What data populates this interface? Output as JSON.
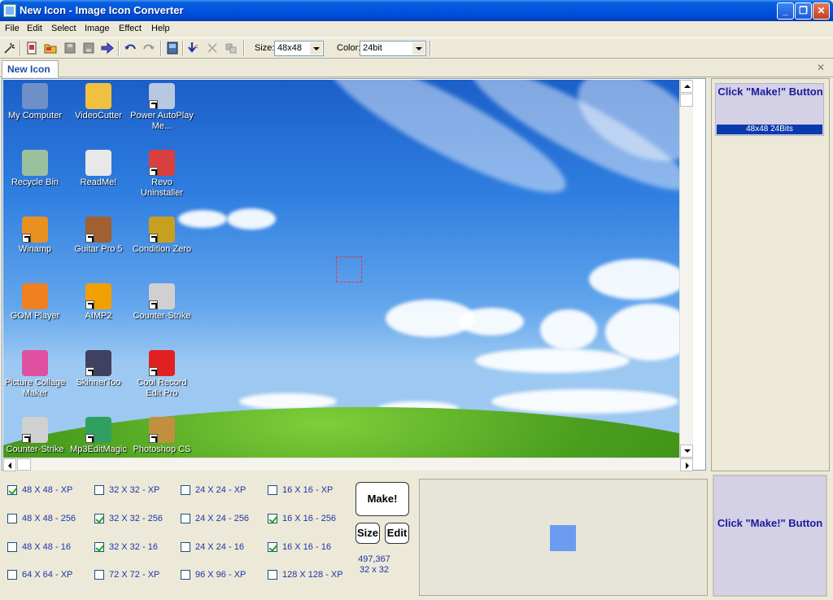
{
  "window": {
    "title": "New Icon - Image Icon Converter",
    "minimize_glyph": "_",
    "maximize_glyph": "❐",
    "close_glyph": "✕"
  },
  "menu": [
    "File",
    "Edit",
    "Select",
    "Image",
    "Effect",
    "Help"
  ],
  "toolbar": {
    "size_label": "Size:",
    "size_value": "48x48",
    "color_label": "Color:",
    "color_value": "24bit"
  },
  "tab": {
    "label": "New Icon",
    "close_glyph": "✕"
  },
  "desktop_icons": [
    {
      "label": "My Computer",
      "color": "#6e8fc8",
      "shortcut": false
    },
    {
      "label": "VideoCutter",
      "color": "#f0c040",
      "shortcut": false
    },
    {
      "label": "Power AutoPlay Me...",
      "color": "#b8c8e0",
      "shortcut": true
    },
    {
      "label": "Recycle Bin",
      "color": "#9ac0a0",
      "shortcut": false
    },
    {
      "label": "ReadMe!",
      "color": "#e8e8e8",
      "shortcut": false
    },
    {
      "label": "Revo Uninstaller",
      "color": "#d84040",
      "shortcut": true
    },
    {
      "label": "Winamp",
      "color": "#e89020",
      "shortcut": true
    },
    {
      "label": "Guitar Pro 5",
      "color": "#a06030",
      "shortcut": true
    },
    {
      "label": "Condition Zero",
      "color": "#c8a020",
      "shortcut": true
    },
    {
      "label": "GOM Player",
      "color": "#f08020",
      "shortcut": false
    },
    {
      "label": "AIMP2",
      "color": "#f0a000",
      "shortcut": true
    },
    {
      "label": "Counter-Strike",
      "color": "#d0d0d0",
      "shortcut": true
    },
    {
      "label": "Picture Collage Maker",
      "color": "#e050a0",
      "shortcut": false
    },
    {
      "label": "SkinnerToo",
      "color": "#404060",
      "shortcut": true
    },
    {
      "label": "Cool Record Edit Pro",
      "color": "#e02020",
      "shortcut": true
    },
    {
      "label": "Counter-Strike",
      "color": "#d0d0d0",
      "shortcut": true
    },
    {
      "label": "Mp3EditMagic",
      "color": "#30a060",
      "shortcut": true
    },
    {
      "label": "Photoshop CS",
      "color": "#c09040",
      "shortcut": true
    }
  ],
  "right_panel": {
    "message": "Click \"Make!\" Button",
    "caption": "48x48 24Bits"
  },
  "options": [
    {
      "label": "48 X 48 - XP",
      "checked": true
    },
    {
      "label": "32 X 32 - XP",
      "checked": false
    },
    {
      "label": "24 X 24 - XP",
      "checked": false
    },
    {
      "label": "16 X 16 - XP",
      "checked": false
    },
    {
      "label": "48 X 48 - 256",
      "checked": false
    },
    {
      "label": "32 X 32 - 256",
      "checked": true
    },
    {
      "label": "24 X 24 - 256",
      "checked": false
    },
    {
      "label": "16 X 16 - 256",
      "checked": true
    },
    {
      "label": "48 X 48 - 16",
      "checked": false
    },
    {
      "label": "32 X 32 - 16",
      "checked": true
    },
    {
      "label": "24 X 24 - 16",
      "checked": false
    },
    {
      "label": "16 X 16 - 16",
      "checked": true
    },
    {
      "label": "64 X 64 - XP",
      "checked": false
    },
    {
      "label": "72 X 72 - XP",
      "checked": false
    },
    {
      "label": "96 X 96 - XP",
      "checked": false
    },
    {
      "label": "128 X 128 - XP",
      "checked": false
    }
  ],
  "buttons": {
    "make": "Make!",
    "size": "Size",
    "edit": "Edit"
  },
  "status": {
    "coords": "497,367",
    "selection": "32 x 32"
  },
  "make_panel": {
    "message": "Click \"Make!\" Button"
  },
  "colors": {
    "title_blue": "#0054e3",
    "label_blue": "#1e34a8",
    "sample_blue": "#6b9cf0"
  }
}
